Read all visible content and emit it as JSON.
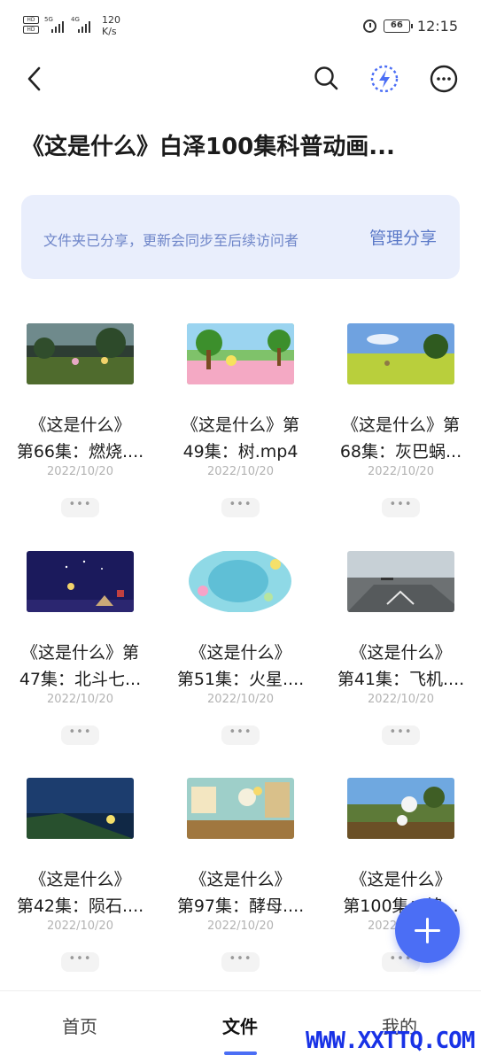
{
  "status_bar": {
    "sim1": "HD",
    "sim2": "HD",
    "net1": "5G",
    "net2": "4G",
    "speed_value": "120",
    "speed_unit": "K/s",
    "battery": "66",
    "time": "12:15"
  },
  "topbar": {
    "back_icon": "chevron-left-icon",
    "search_icon": "search-icon",
    "flash_icon": "lightning-icon",
    "more_icon": "more-horizontal-icon"
  },
  "folder_title": "《这是什么》白泽100集科普动画...",
  "share_banner": {
    "text": "文件夹已分享，更新会同步至后续访问者",
    "action": "管理分享"
  },
  "files": [
    {
      "line1": "《这是什么》",
      "line2": "第66集：燃烧....",
      "date": "2022/10/20",
      "more": "•••"
    },
    {
      "line1": "《这是什么》第",
      "line2": "49集：树.mp4",
      "date": "2022/10/20",
      "more": "•••"
    },
    {
      "line1": "《这是什么》第",
      "line2": "68集：灰巴蜗...",
      "date": "2022/10/20",
      "more": "•••"
    },
    {
      "line1": "《这是什么》第",
      "line2": "47集：北斗七...",
      "date": "2022/10/20",
      "more": "•••"
    },
    {
      "line1": "《这是什么》",
      "line2": "第51集：火星....",
      "date": "2022/10/20",
      "more": "•••"
    },
    {
      "line1": "《这是什么》",
      "line2": "第41集：飞机....",
      "date": "2022/10/20",
      "more": "•••"
    },
    {
      "line1": "《这是什么》",
      "line2": "第42集：陨石....",
      "date": "2022/10/20",
      "more": "•••"
    },
    {
      "line1": "《这是什么》",
      "line2": "第97集：酵母....",
      "date": "2022/10/20",
      "more": "•••"
    },
    {
      "line1": "《这是什么》",
      "line2": "第100集：棉...",
      "date": "2022/10/20",
      "more": "•••"
    }
  ],
  "fab_icon": "plus-icon",
  "tabs": [
    {
      "label": "首页"
    },
    {
      "label": "文件"
    },
    {
      "label": "我的"
    }
  ],
  "active_tab": "文件",
  "watermark": "WWW.XXTTQ.COM",
  "colors": {
    "accent": "#4b6ef5",
    "banner_bg": "#e9eefc",
    "banner_text": "#6f86c9"
  }
}
